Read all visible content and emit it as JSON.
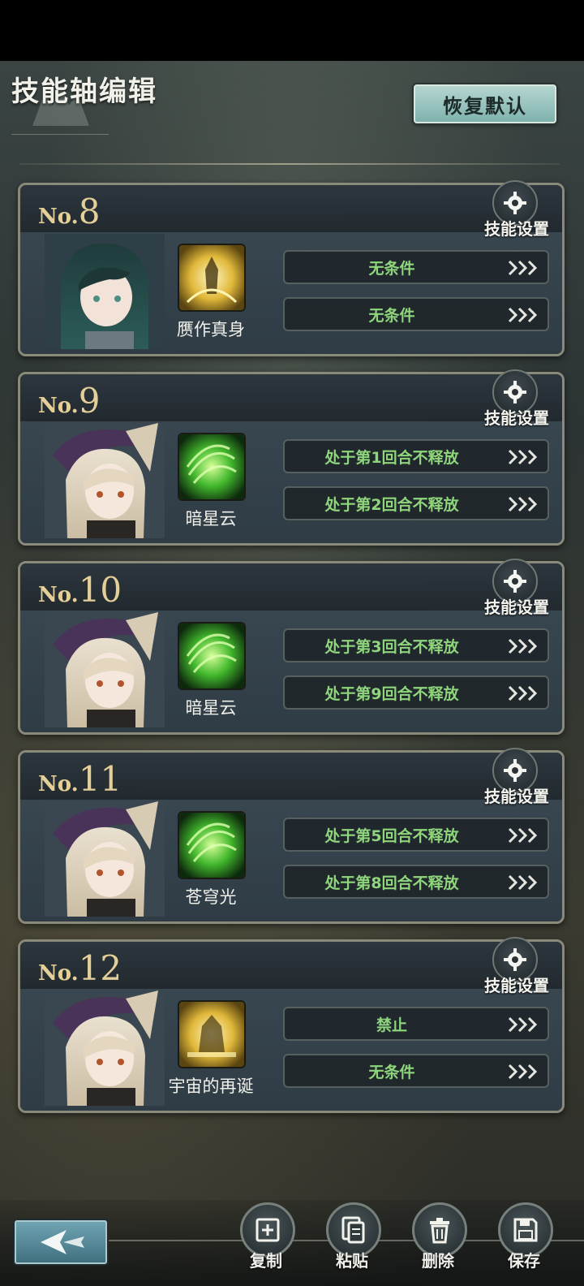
{
  "header": {
    "title": "技能轴编辑",
    "reset_label": "恢复默认"
  },
  "slots": [
    {
      "no_prefix": "No.",
      "no_number": "8",
      "gear_label": "技能设置",
      "skill_name": "赝作真身",
      "skill_icon": "golden-figure-icon",
      "conditions": [
        "无条件",
        "无条件"
      ]
    },
    {
      "no_prefix": "No.",
      "no_number": "9",
      "gear_label": "技能设置",
      "skill_name": "暗星云",
      "skill_icon": "green-swirl-icon",
      "conditions": [
        "处于第1回合不释放",
        "处于第2回合不释放"
      ]
    },
    {
      "no_prefix": "No.",
      "no_number": "10",
      "gear_label": "技能设置",
      "skill_name": "暗星云",
      "skill_icon": "green-swirl-icon",
      "conditions": [
        "处于第3回合不释放",
        "处于第9回合不释放"
      ]
    },
    {
      "no_prefix": "No.",
      "no_number": "11",
      "gear_label": "技能设置",
      "skill_name": "苍穹光",
      "skill_icon": "green-swirl-icon",
      "conditions": [
        "处于第5回合不释放",
        "处于第8回合不释放"
      ]
    },
    {
      "no_prefix": "No.",
      "no_number": "12",
      "gear_label": "技能设置",
      "skill_name": "宇宙的再诞",
      "skill_icon": "golden-knight-icon",
      "conditions": [
        "禁止",
        "无条件"
      ]
    }
  ],
  "actions": {
    "copy": "复制",
    "paste": "粘贴",
    "delete": "删除",
    "save": "保存"
  },
  "colors": {
    "accent_gold": "#e5cf99",
    "condition_green": "#8ed57c",
    "reset_teal": "#7fb2ad"
  }
}
